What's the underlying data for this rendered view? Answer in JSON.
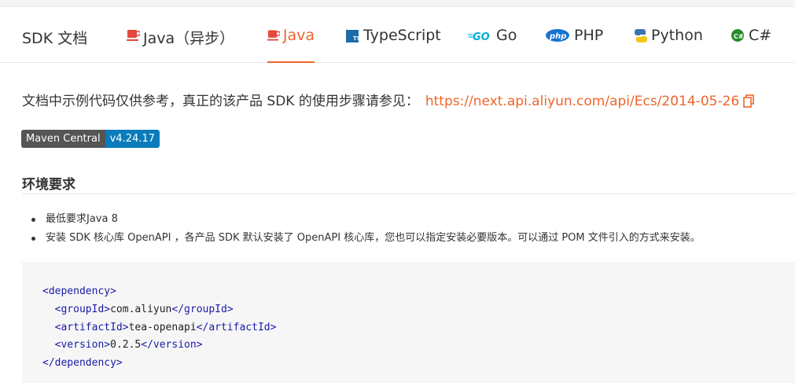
{
  "header": {
    "title": "SDK 文档",
    "tabs": [
      {
        "label": "Java（异步）",
        "icon": "java-cup-icon",
        "active": false
      },
      {
        "label": "Java",
        "icon": "java-cup-icon",
        "active": true
      },
      {
        "label": "TypeScript",
        "icon": "typescript-icon",
        "active": false
      },
      {
        "label": "Go",
        "icon": "go-icon",
        "active": false
      },
      {
        "label": "PHP",
        "icon": "php-icon",
        "active": false
      },
      {
        "label": "Python",
        "icon": "python-icon",
        "active": false
      },
      {
        "label": "C#",
        "icon": "csharp-icon",
        "active": false
      }
    ]
  },
  "intro": {
    "text": "文档中示例代码仅供参考，真正的该产品 SDK 的使用步骤请参见：",
    "link": "https://next.api.aliyun.com/api/Ecs/2014-05-26"
  },
  "badge": {
    "left": "Maven Central",
    "right": "v4.24.17"
  },
  "section": {
    "title": "环境要求",
    "items": [
      "最低要求Java 8",
      "安装 SDK 核心库 OpenAPI ，各产品 SDK 默认安装了 OpenAPI 核心库，您也可以指定安装必要版本。可以通过 POM 文件引入的方式来安装。"
    ]
  },
  "code": {
    "line1": "<dependency>",
    "line2_open": "<groupId>",
    "line2_val": "com.aliyun",
    "line2_close": "</groupId>",
    "line3_open": "<artifactId>",
    "line3_val": "tea-openapi",
    "line3_close": "</artifactId>",
    "line4_open": "<version>",
    "line4_val": "0.2.5",
    "line4_close": "</version>",
    "line5": "</dependency>"
  },
  "colors": {
    "accent": "#f0642b",
    "badge_right": "#0a7bbb",
    "badge_left": "#555555",
    "code_tag": "#1a1aa6"
  }
}
